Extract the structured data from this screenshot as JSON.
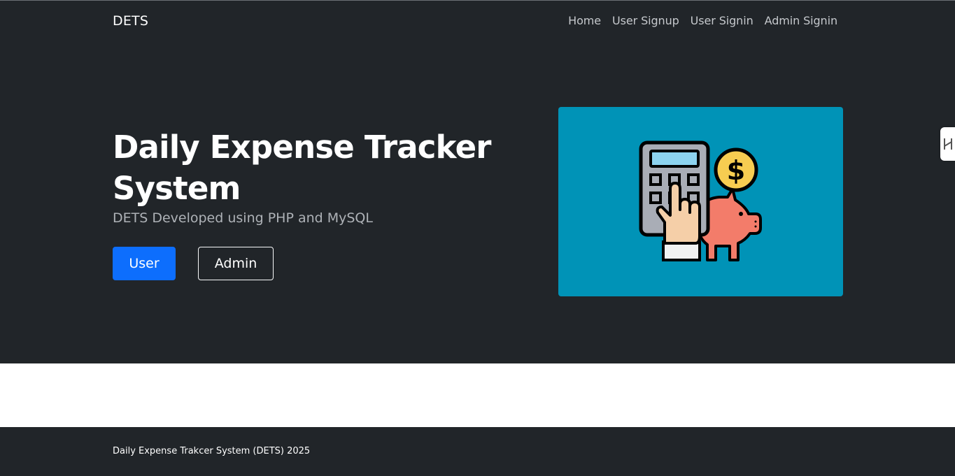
{
  "navbar": {
    "brand": "DETS",
    "links": [
      {
        "label": "Home"
      },
      {
        "label": "User Signup"
      },
      {
        "label": "User Signin"
      },
      {
        "label": "Admin Signin"
      }
    ]
  },
  "hero": {
    "title": "Daily Expense Tracker System",
    "subtitle": "DETS Developed using PHP and MySQL",
    "buttons": {
      "user_label": "User",
      "admin_label": "Admin"
    },
    "illustration": {
      "icons": [
        "calculator-icon",
        "dollar-coin-icon",
        "piggy-bank-icon",
        "hand-pointer-icon"
      ],
      "background_color": "#0093b7"
    }
  },
  "footer": {
    "text": "Daily Expense Trakcer System (DETS) 2025"
  },
  "colors": {
    "dark_bg": "#212529",
    "primary": "#0d6efd",
    "nav_link": "#c5c8cc",
    "subtitle": "#aeb2b7"
  }
}
